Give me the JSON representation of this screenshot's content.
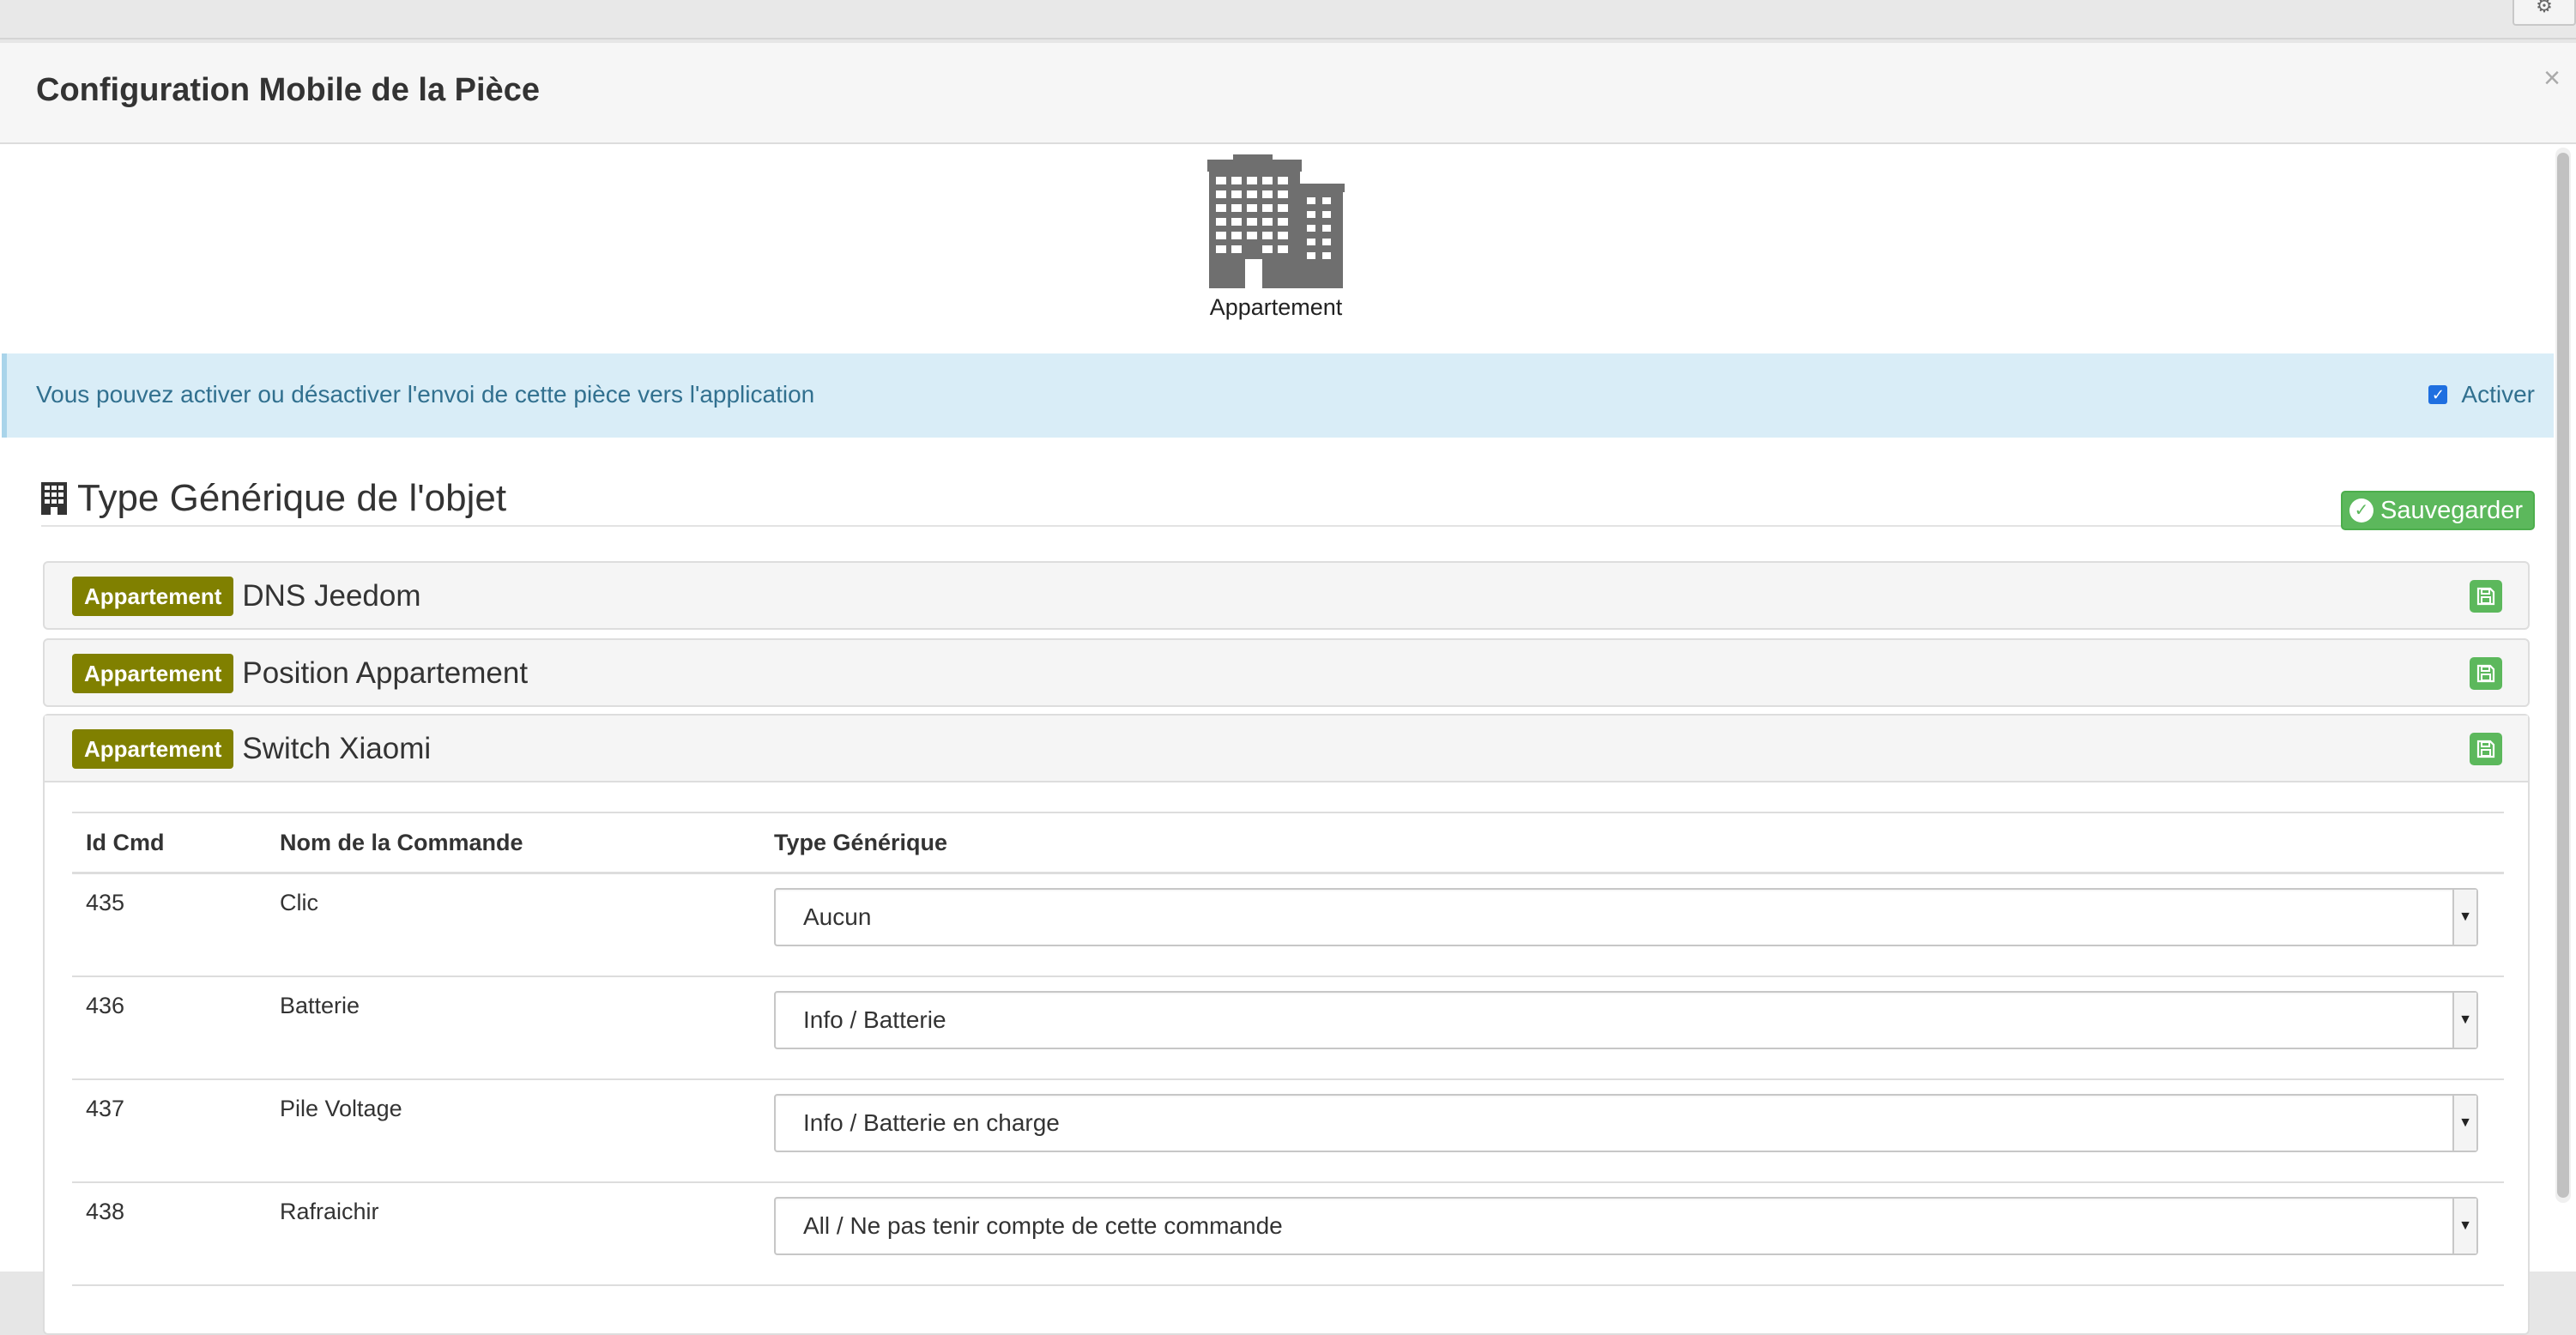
{
  "modal": {
    "title": "Configuration Mobile de la Pièce",
    "close_label": "×"
  },
  "room": {
    "icon": "building-icon",
    "name": "Appartement"
  },
  "alert": {
    "text": "Vous pouvez activer ou désactiver l'envoi de cette pièce vers l'application",
    "checkbox_label": "Activer",
    "checked": true
  },
  "section": {
    "title": "Type Générique de l'objet",
    "save_label": "Sauvegarder"
  },
  "panels": [
    {
      "badge": "Appartement",
      "name": "DNS Jeedom"
    },
    {
      "badge": "Appartement",
      "name": "Position Appartement"
    },
    {
      "badge": "Appartement",
      "name": "Switch Xiaomi"
    }
  ],
  "table": {
    "headers": [
      "Id Cmd",
      "Nom de la Commande",
      "Type Générique"
    ],
    "rows": [
      {
        "id": "435",
        "name": "Clic",
        "type": "Aucun"
      },
      {
        "id": "436",
        "name": "Batterie",
        "type": "Info / Batterie"
      },
      {
        "id": "437",
        "name": "Pile Voltage",
        "type": "Info / Batterie en charge"
      },
      {
        "id": "438",
        "name": "Rafraichir",
        "type": "All / Ne pas tenir compte de cette commande"
      }
    ]
  },
  "colors": {
    "badge": "#808000",
    "success": "#5cb85c",
    "alert_bg": "#d9edf7",
    "alert_text": "#31708f"
  }
}
